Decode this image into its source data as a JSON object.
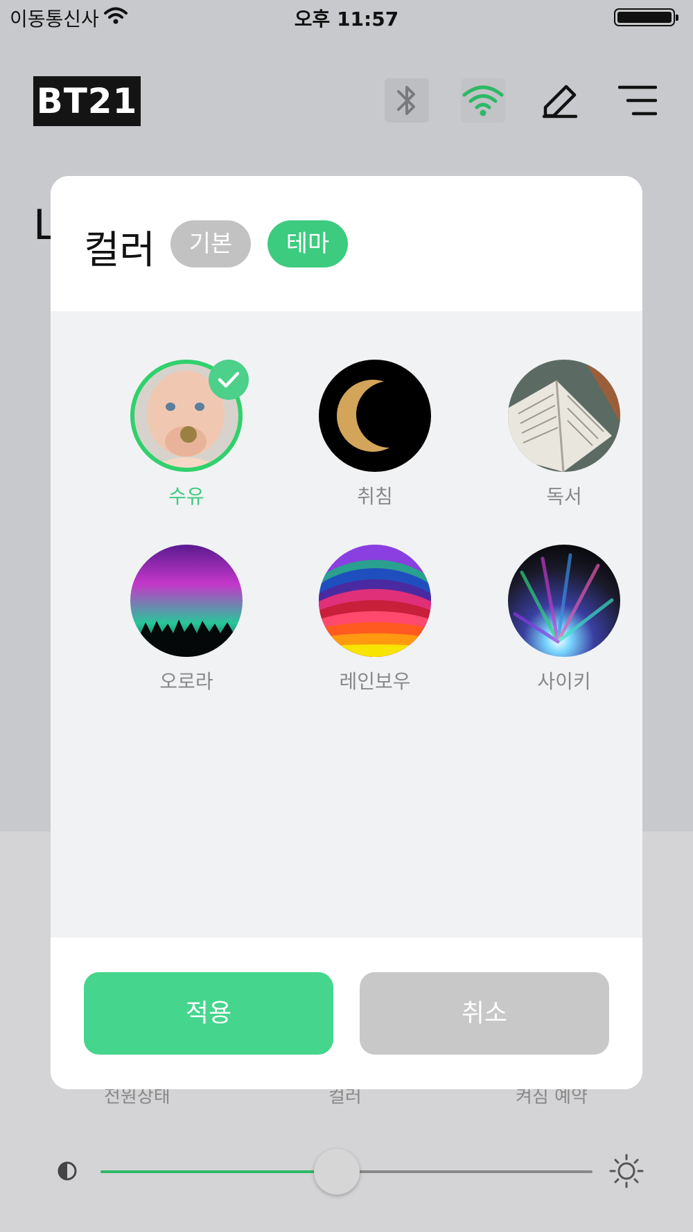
{
  "status_bar": {
    "carrier": "이동통신사",
    "time": "오후 11:57"
  },
  "header": {
    "logo": "BT21",
    "icons": [
      "bluetooth-icon",
      "wifi-icon",
      "edit-icon",
      "menu-icon"
    ]
  },
  "background": {
    "partial_text": "L",
    "bottom_labels": [
      "전원상태",
      "컬러",
      "켜짐 예약"
    ],
    "brightness_level": 0.48
  },
  "modal": {
    "title": "컬러",
    "tabs": [
      {
        "label": "기본",
        "active": false
      },
      {
        "label": "테마",
        "active": true
      }
    ],
    "themes": [
      {
        "label": "수유",
        "selected": true
      },
      {
        "label": "취침",
        "selected": false
      },
      {
        "label": "독서",
        "selected": false
      },
      {
        "label": "오로라",
        "selected": false
      },
      {
        "label": "레인보우",
        "selected": false
      },
      {
        "label": "사이키",
        "selected": false
      }
    ],
    "apply_label": "적용",
    "cancel_label": "취소"
  },
  "colors": {
    "accent": "#3ccb7f",
    "apply": "#45d58d",
    "inactive": "#c8c8c8"
  }
}
